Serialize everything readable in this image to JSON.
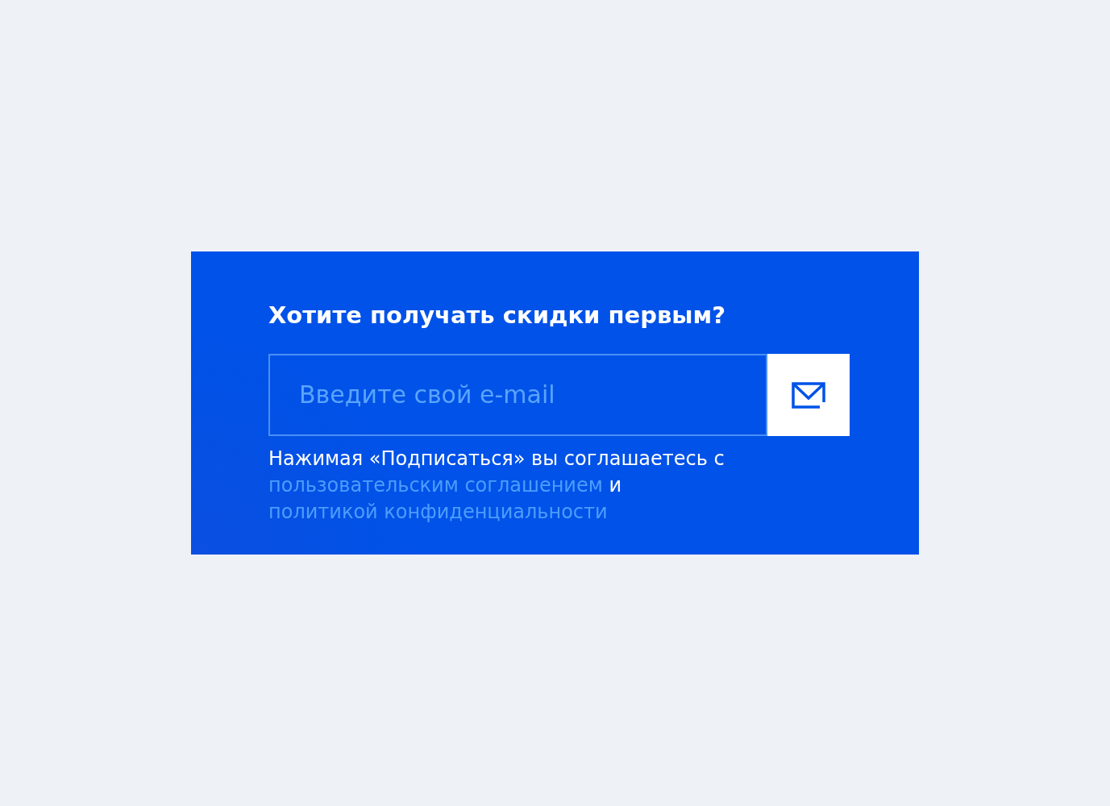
{
  "title": "Хотите получать скидки первым?",
  "email_field": {
    "placeholder": "Введите свой e-mail"
  },
  "consent": {
    "text_before": "Нажимая «Подписаться» вы соглашаетесь с",
    "user_agreement_link": "пользовательским соглашением",
    "text_between": "и",
    "privacy_policy_link": "политикой конфиденциальности"
  }
}
